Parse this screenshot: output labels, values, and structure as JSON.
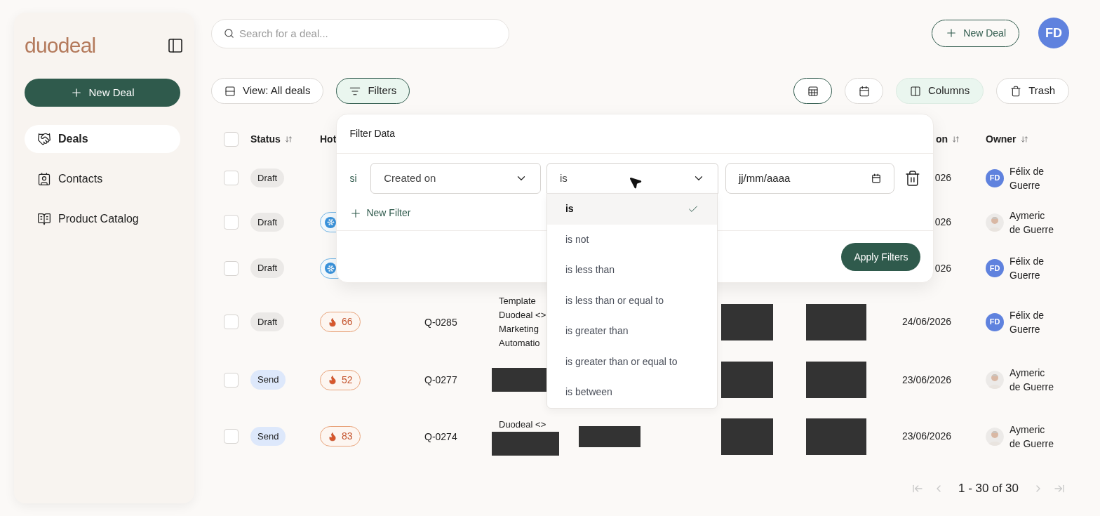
{
  "sidebar": {
    "logo": "duodeal",
    "new_deal": "New Deal",
    "items": [
      {
        "label": "Deals",
        "selected": true
      },
      {
        "label": "Contacts",
        "selected": false
      },
      {
        "label": "Product Catalog",
        "selected": false
      }
    ]
  },
  "search": {
    "placeholder": "Search for a deal..."
  },
  "header": {
    "new_deal": "New Deal",
    "avatar": "FD"
  },
  "toolbar": {
    "left": [
      {
        "label": "View: All deals",
        "selected": false
      },
      {
        "label": "Filters",
        "selected": true
      }
    ],
    "views": [
      {
        "selected": true
      },
      {
        "selected": false
      }
    ],
    "right": [
      {
        "label": "Columns",
        "selected": true
      },
      {
        "label": "Trash",
        "selected": false
      }
    ]
  },
  "table": {
    "all_checked": false,
    "columns": [
      {
        "label": "Status"
      },
      {
        "label": "Hot"
      },
      {
        "label": "on"
      },
      {
        "label": "Owner"
      }
    ],
    "rows": [
      {
        "checked": false,
        "status": {
          "label": "Draft",
          "kind": "draft"
        },
        "date": "026",
        "owner": {
          "kind": "initials",
          "initials": "FD",
          "name": "Félix de Guerre"
        }
      },
      {
        "checked": false,
        "status": {
          "label": "Draft",
          "kind": "draft"
        },
        "hot": {
          "kind": "cold"
        },
        "date": "026",
        "owner": {
          "name": "Aymeric de Guerre"
        }
      },
      {
        "checked": false,
        "status": {
          "label": "Draft",
          "kind": "draft"
        },
        "hot": {
          "kind": "cold"
        },
        "date": "026",
        "owner": {
          "kind": "initials",
          "initials": "FD",
          "name": "Félix de Guerre"
        }
      },
      {
        "checked": false,
        "status": {
          "label": "Draft",
          "kind": "draft"
        },
        "hot": {
          "kind": "hot",
          "score": "66"
        },
        "quote": "Q-0285",
        "name": "Template Duodeal <> Marketing Automatio",
        "redacted_cells": [
          {
            "kind": "col_6"
          },
          {
            "kind": "col_7"
          }
        ],
        "date": "24/06/2026",
        "owner": {
          "kind": "initials",
          "initials": "FD",
          "name": "Félix de Guerre"
        }
      },
      {
        "checked": false,
        "status": {
          "label": "Send",
          "kind": "send"
        },
        "hot": {
          "kind": "hot",
          "score": "52"
        },
        "quote": "Q-0277",
        "redacted_cells": [
          {
            "kind": "name"
          },
          {
            "kind": "col_6"
          },
          {
            "kind": "col_7"
          }
        ],
        "date": "23/06/2026",
        "owner": {
          "name": "Aymeric de Guerre"
        }
      },
      {
        "checked": false,
        "status": {
          "label": "Send",
          "kind": "send"
        },
        "hot": {
          "kind": "hot",
          "score": "83"
        },
        "quote": "Q-0274",
        "name": "Duodeal <>",
        "redacted_cells": [
          {
            "kind": "name"
          },
          {
            "kind": "col_5"
          },
          {
            "kind": "col_6"
          },
          {
            "kind": "col_7"
          }
        ],
        "date": "23/06/2026",
        "owner": {
          "name": "Aymeric de Guerre"
        }
      }
    ]
  },
  "pagination": {
    "range": "1 - 30 of 30",
    "first_disabled": true,
    "last_disabled": true
  },
  "filter_panel": {
    "title": "Filter Data",
    "conjunction": "si",
    "field": "Created on",
    "operator": "is",
    "date_placeholder": "jj/mm/aaaa",
    "new_filter": "New Filter",
    "apply": "Apply Filters",
    "operator_options": [
      {
        "label": "is",
        "selected": true
      },
      {
        "label": "is not",
        "selected": false
      },
      {
        "label": "is less than",
        "selected": false
      },
      {
        "label": "is less than or equal to",
        "selected": false
      },
      {
        "label": "is greater than",
        "selected": false
      },
      {
        "label": "is greater than or equal to",
        "selected": false
      },
      {
        "label": "is between",
        "selected": false
      }
    ]
  }
}
